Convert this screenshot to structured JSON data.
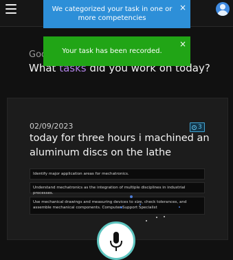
{
  "greeting": "Goo",
  "question": {
    "before": "What ",
    "highlight": "tasks",
    "after": " did you work on today?"
  },
  "notifications": [
    {
      "message": "We categorized your task in one or more competencies",
      "close": "×",
      "color": "#2d8fd8"
    },
    {
      "message": "Your task has been recorded.",
      "close": "×",
      "color": "#21a516"
    }
  ],
  "task": {
    "date": "02/09/2023",
    "text": "today for three hours i machined an aluminum discs on the lathe",
    "hours_badge": "3",
    "competencies": [
      "Identify major application areas for mechatronics.",
      "Understand mechatronics as the integration of multiple disciplines in industrial processes.",
      "Use mechanical drawings and measuring devices to size, check tolerances, and assemble mechanical components. Computer Support Specialist"
    ]
  },
  "icons": {
    "menu": "hamburger-menu-icon",
    "profile": "user-avatar-icon",
    "clock": "clock-icon",
    "mic": "microphone-icon"
  },
  "colors": {
    "accent": "#b083e6",
    "info": "#2d8fd8",
    "success": "#21a516",
    "badge": "#42a6d6",
    "mic_ring": "#5ec5c0"
  }
}
